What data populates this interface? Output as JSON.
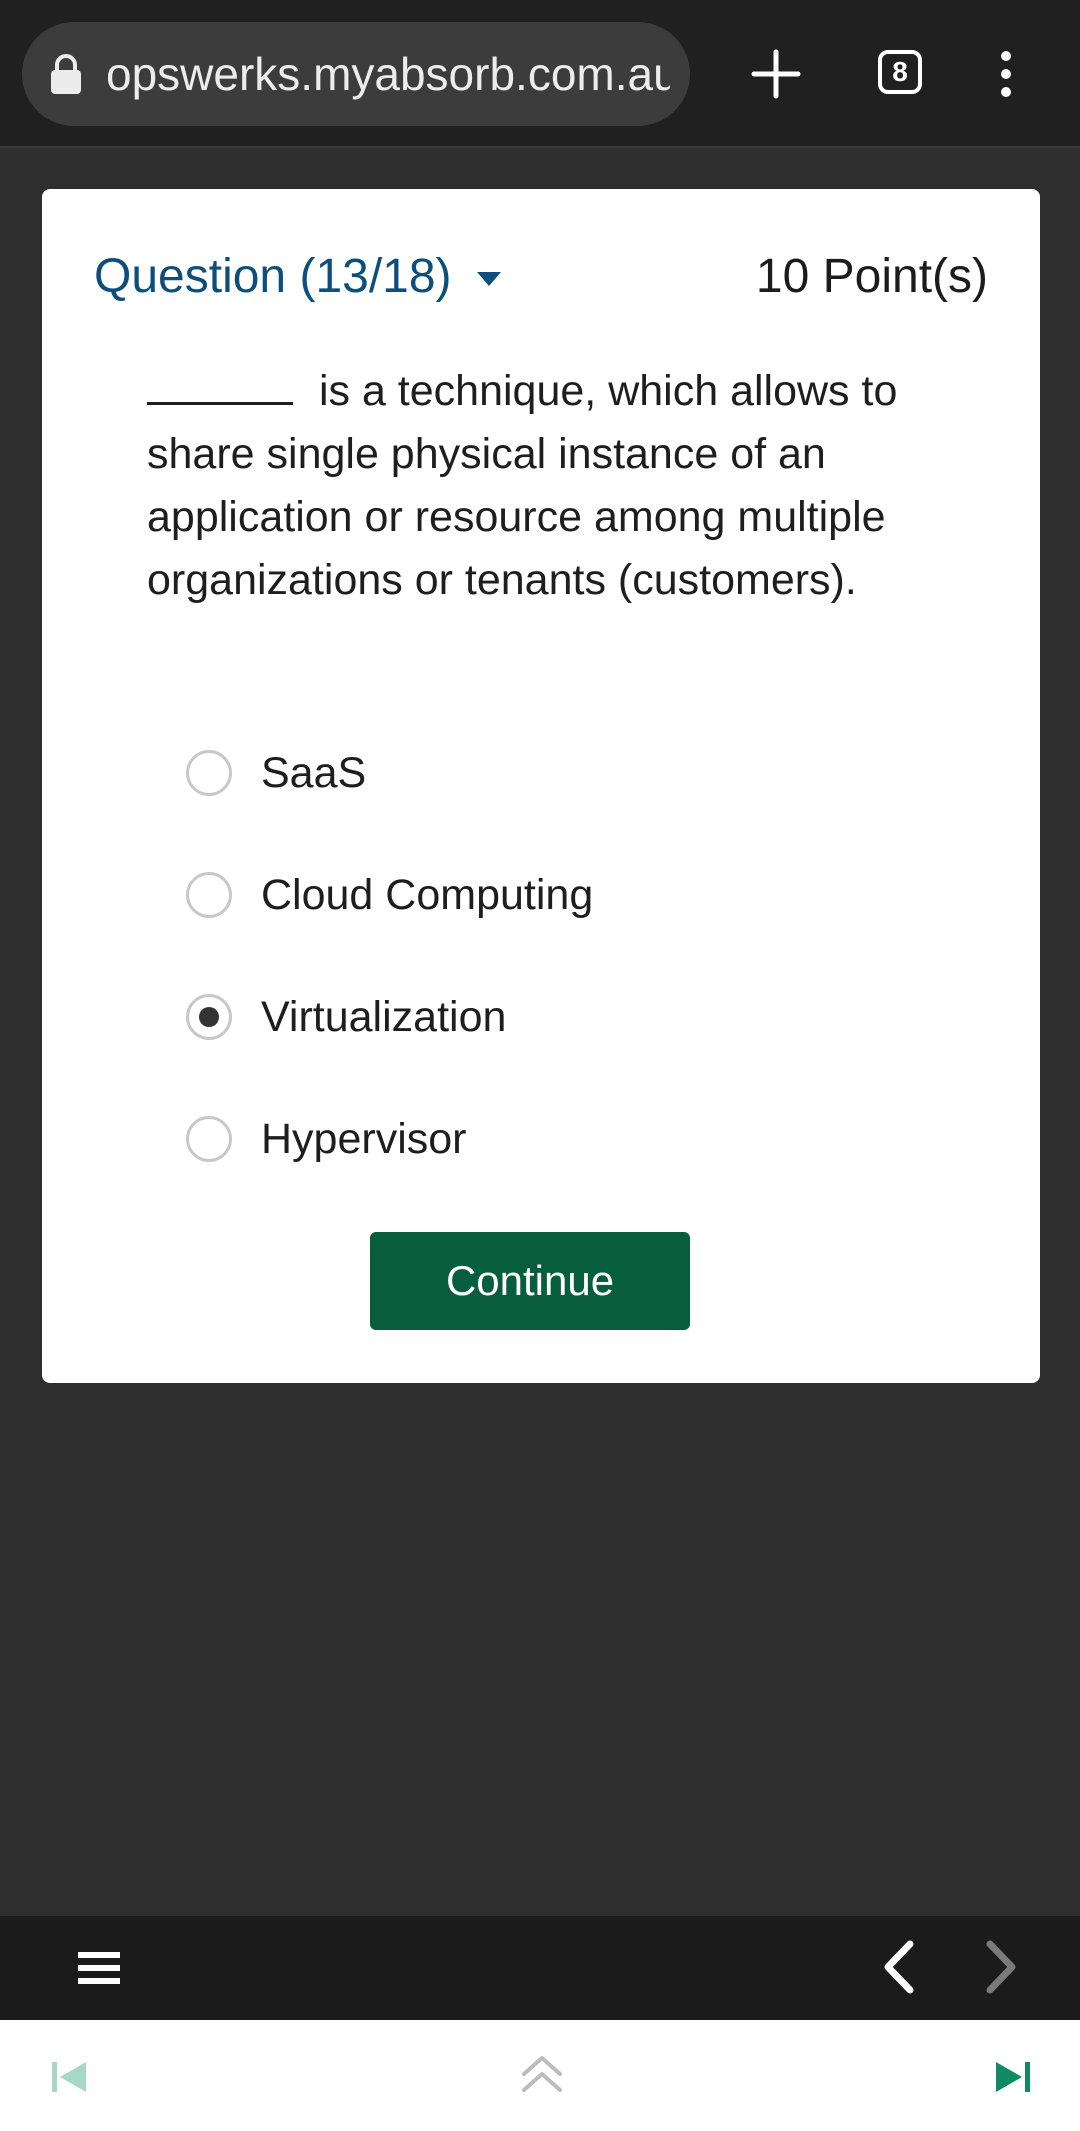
{
  "browser": {
    "url": "opswerks.myabsorb.com.au",
    "tab_count": "8",
    "icons": [
      "lock-icon",
      "plus-icon",
      "tab-count-icon",
      "more-vertical-icon"
    ]
  },
  "quiz": {
    "question_label": "Question (13/18)",
    "points": "10 Point(s)",
    "question_text": " is a technique, which allows to share single physical instance of an application or resource among multiple organizations or tenants (customers).",
    "options": [
      {
        "label": "SaaS",
        "selected": false
      },
      {
        "label": "Cloud Computing",
        "selected": false
      },
      {
        "label": "Virtualization",
        "selected": true
      },
      {
        "label": "Hypervisor",
        "selected": false
      }
    ],
    "continue_label": "Continue",
    "accent_color": "#065e3e",
    "link_color": "#0c4f7c"
  },
  "nav": {
    "icons": [
      "menu-icon",
      "chevron-left-icon",
      "chevron-right-icon",
      "skip-first-icon",
      "double-chevron-up-icon",
      "skip-last-icon"
    ]
  }
}
